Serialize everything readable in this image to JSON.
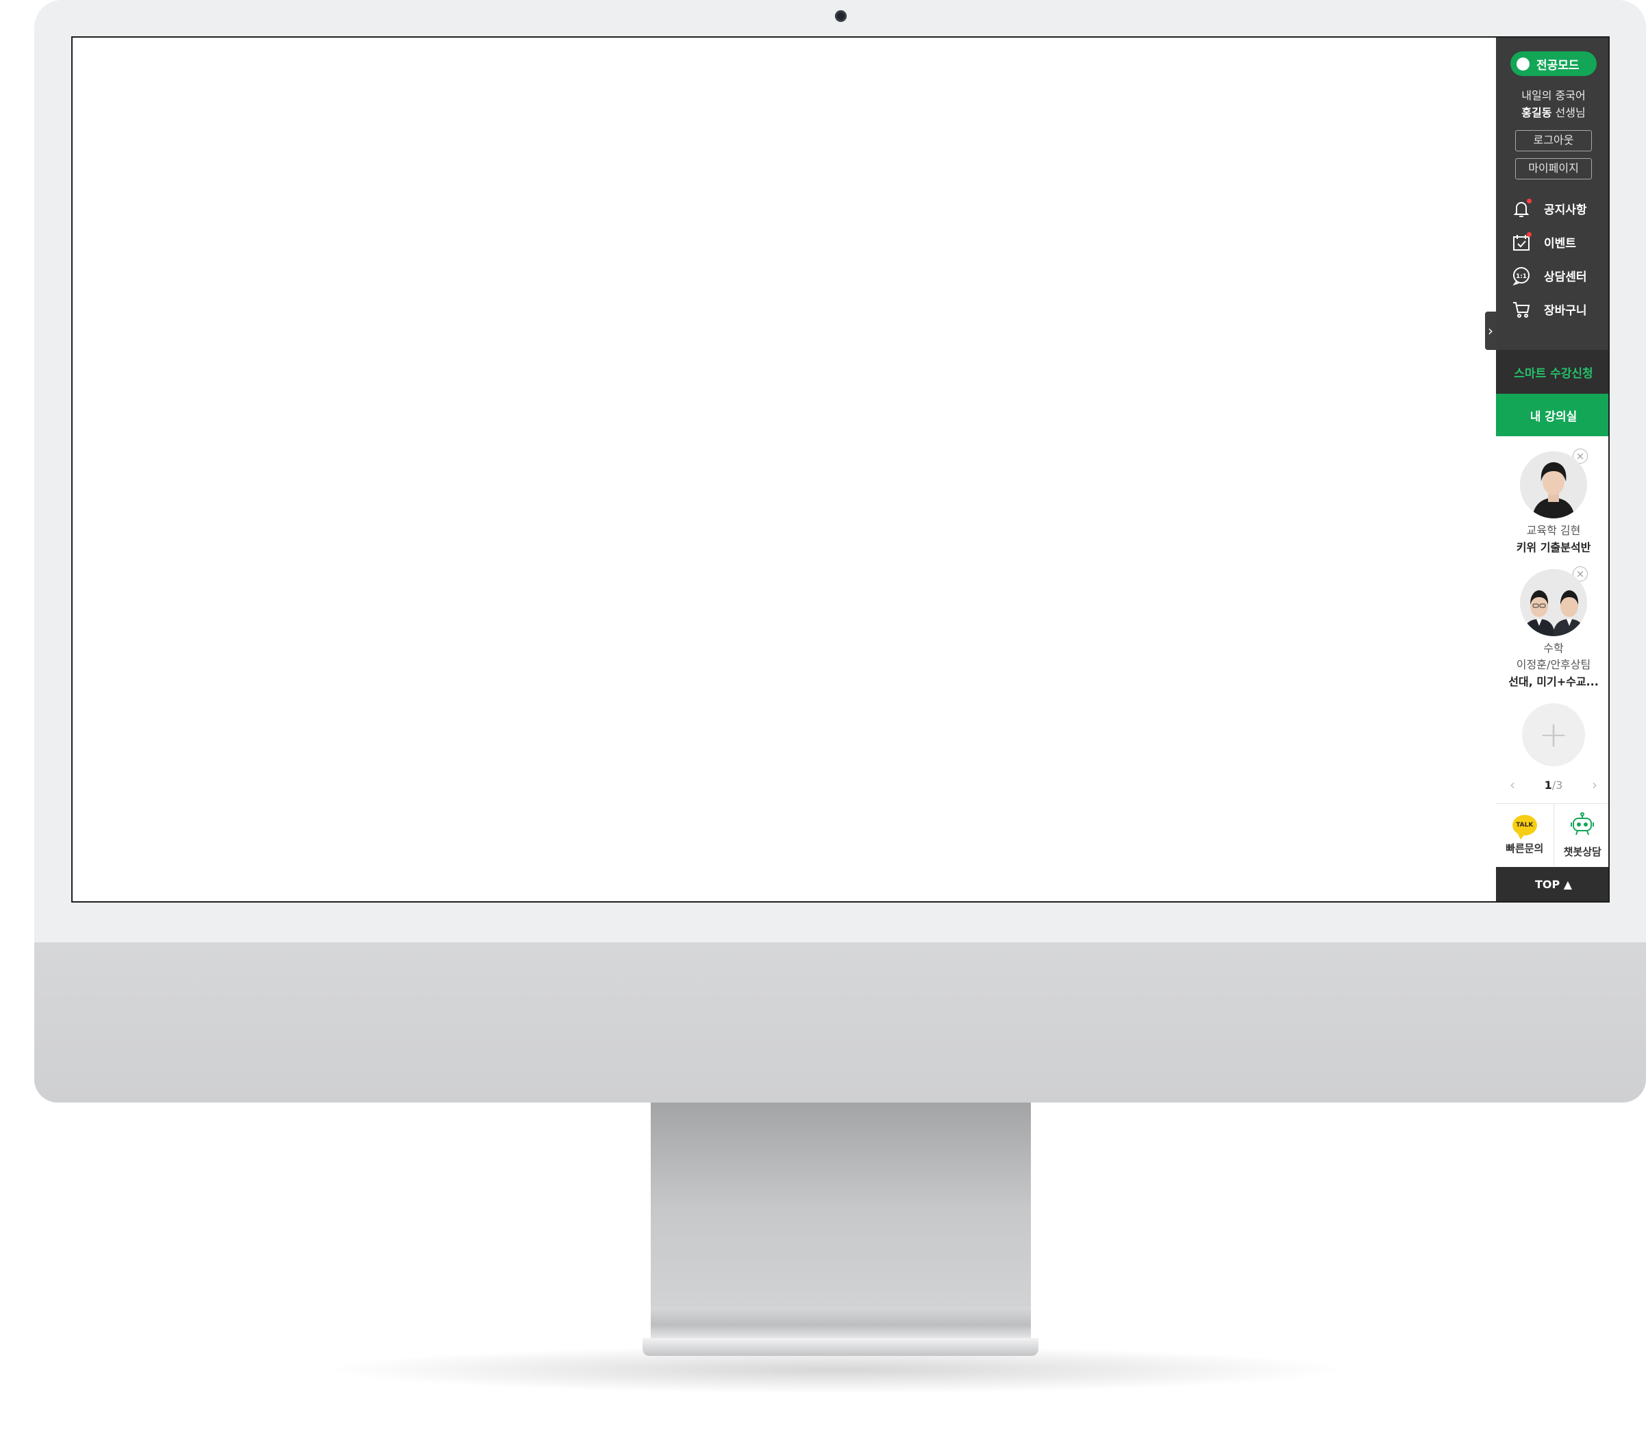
{
  "colors": {
    "accent": "#13a657",
    "dark_panel": "#3c3c3c",
    "smart_text": "#22c26a",
    "notice_dot": "#ff3b3b",
    "kakao": "#f6cf14"
  },
  "toggle": {
    "icon": "chevron-right-icon",
    "glyph": "›"
  },
  "quick_menu": {
    "mode_label": "전공모드",
    "user": {
      "line1": "내일의 중국어",
      "name": "홍길동",
      "suffix": " 선생님"
    },
    "logout_label": "로그아웃",
    "mypage_label": "마이페이지",
    "nav": [
      {
        "label": "공지사항",
        "icon": "bell-icon",
        "badge": true
      },
      {
        "label": "이벤트",
        "icon": "calendar-check-icon",
        "badge": true
      },
      {
        "label": "상담센터",
        "icon": "chat-1on1-icon",
        "badge": false
      },
      {
        "label": "장바구니",
        "icon": "cart-icon",
        "badge": false
      }
    ],
    "smart_label": "스마트 수강신청",
    "classroom_label": "내 강의실",
    "courses": [
      {
        "lines": [
          "교육학 김현"
        ],
        "title": "키위 기출분석반",
        "close": "×"
      },
      {
        "lines": [
          "수학",
          "이정훈/안후상팀"
        ],
        "title": "선대, 미기+수교...",
        "close": "×"
      }
    ],
    "add_glyph": "+",
    "pager": {
      "prev": "‹",
      "next": "›",
      "current": "1",
      "total": "/3"
    },
    "quick_inquiry": {
      "icon_text": "TALK",
      "label": "빠른문의"
    },
    "chatbot": {
      "label": "챗봇상담"
    },
    "top_label": "TOP ▲"
  }
}
